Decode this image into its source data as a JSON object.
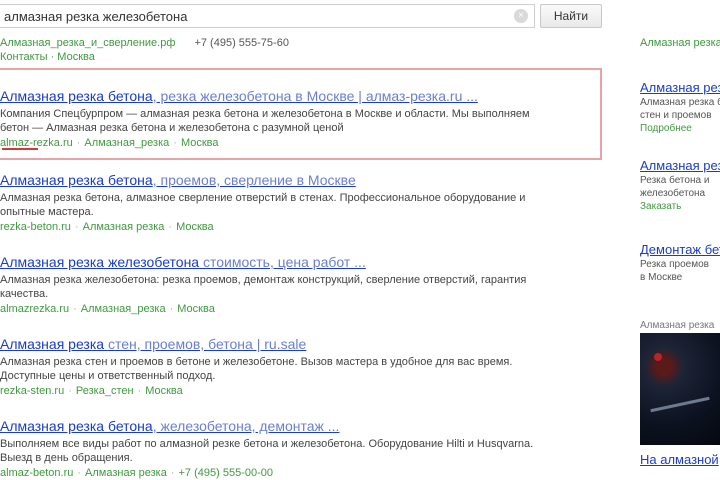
{
  "search": {
    "query": "алмазная резка железобетона",
    "clear_icon": "×",
    "button_label": "Найти"
  },
  "ad_top": {
    "site": "Алмазная_резка_и_сверление.рф",
    "phone": "+7 (495) 555-75-60",
    "sublinks": "Контакты · Москва"
  },
  "results": [
    {
      "title_main": "Алмазная резка бетона",
      "title_light": ", резка железобетона в Москве | алмаз-резка.ru ...",
      "snippet1": "Компания Спецбурпром — алмазная резка бетона и железобетона в Москве и области. Мы выполняем",
      "snippet2": "бетон — Алмазная резка бетона и железобетона с разумной ценой",
      "url": "almaz-rezka.ru",
      "city_label": "Алмазная_резка",
      "region": "Москва"
    },
    {
      "title_main": "Алмазная резка бетона",
      "title_light": ", проемов, сверление в Москве",
      "snippet1": "Алмазная резка бетона, алмазное сверление отверстий в стенах. Профессиональное оборудование и",
      "snippet2": "опытные мастера.",
      "url": "rezka-beton.ru",
      "city_label": "Алмазная резка",
      "region": "Москва"
    },
    {
      "title_main": "Алмазная резка железобетона",
      "title_light": " стоимость, цена работ ...",
      "snippet1": "Алмазная резка железобетона: резка проемов, демонтаж конструкций, сверление отверстий, гарантия",
      "snippet2": "качества.",
      "url": "almazrezka.ru",
      "city_label": "Алмазная_резка",
      "region": "Москва"
    },
    {
      "title_main": "Алмазная резка",
      "title_light": " стен, проемов, бетона | ru.sale",
      "snippet1": "Алмазная резка стен и проемов в бетоне и железобетоне. Вызов мастера в удобное для вас время.",
      "snippet2": "Доступные цены и ответственный подход.",
      "url": "rezka-sten.ru",
      "city_label": "Резка_стен",
      "region": "Москва"
    },
    {
      "title_main": "Алмазная резка бетона",
      "title_light": ", железобетона, демонтаж ...",
      "snippet1": "Выполняем все виды работ по алмазной резке бетона и железобетона. Оборудование Hilti и Husqvarna.",
      "snippet2": "Выезд в день обращения.",
      "url": "almaz-beton.ru",
      "city_label": "Алмазная резка",
      "region": "+7 (495) 555-00-00"
    }
  ],
  "sidebar": {
    "top_text": "Алмазная резка в Москве",
    "ads": [
      {
        "title": "Алмазная резка",
        "snippet1": "Алмазная резка бетона",
        "snippet2": "стен и проемов",
        "link": "Подробнее"
      },
      {
        "title": "Алмазная резка",
        "snippet1": "Резка бетона и",
        "snippet2": "железобетона",
        "link": "Заказать"
      },
      {
        "title": "Демонтаж бетона",
        "snippet1": "Резка проемов",
        "snippet2": "в Москве",
        "link": "Москва"
      }
    ],
    "image_label": "Алмазная резка",
    "caption": "На алмазной"
  }
}
